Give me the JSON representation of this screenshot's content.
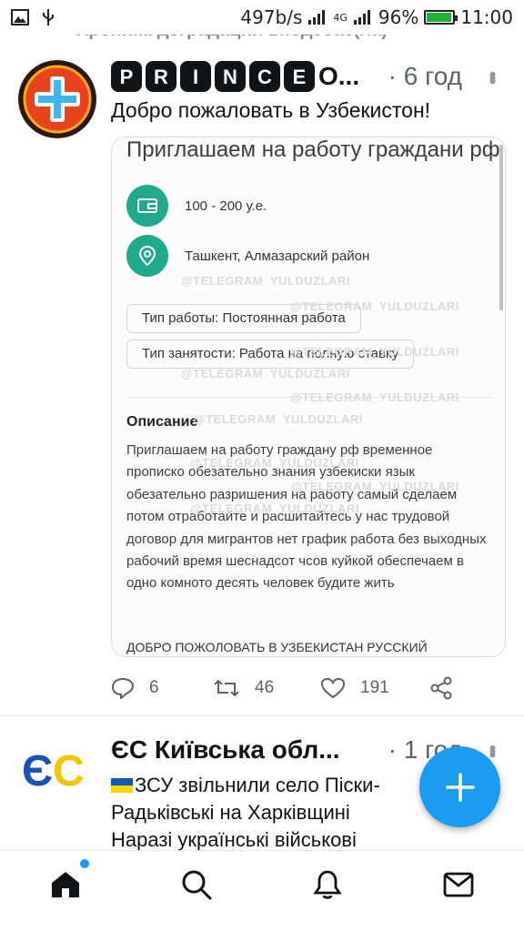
{
  "status_bar": {
    "speed": "497b/s",
    "network": "4G",
    "battery_percent": "96%",
    "battery_level": 0.96,
    "time": "11:00"
  },
  "context_line": "Хроника деградации вподсбас(ла)",
  "tweet1": {
    "name_letters": [
      "P",
      "R",
      "I",
      "N",
      "C",
      "E"
    ],
    "name_tail": "O...",
    "time": "· 6 год",
    "text": "Добро пожаловать в Узбекистон!",
    "media": {
      "title": "Приглашаем на работу граждани рф",
      "salary": "100 - 200 у.е.",
      "location": "Ташкент, Алмазарский район",
      "chip_work_type": "Тип работы: Постоянная работа",
      "chip_employment": "Тип занятости: Работа на полную ставку",
      "description_heading": "Описание",
      "description": "Приглашаем на работу гражданy рф временное прописко обезательно знания узбекиски язык обезательно разришения на работу самый сделаем потом отработайте и расшитайтесь у нас трудовой договор для мигрантов нет график работа без выходных рабочий время шеснадсот чсов куйкой обеспечаем в одно комното десять человек будите жить",
      "footer": "ДОБРО ПОЖОЛОВАТЬ В УЗБЕКИСТАН РУССКИЙ",
      "watermark": "@TELEGRAM_YULDUZLARI"
    },
    "replies": "6",
    "retweets": "46",
    "likes": "191"
  },
  "tweet2": {
    "name": "ЄС Київська обл...",
    "time": "· 1 год",
    "avatar_text": "ЄС",
    "text": "ЗСУ звільнили село Піски-Радьківські на Харківщині\nНаразі українські військові"
  },
  "colors": {
    "accent": "#1d9bf0",
    "teal": "#21a98c",
    "text": "#0f1419",
    "muted": "#536471"
  },
  "icons": {
    "nav": [
      "home-icon",
      "search-icon",
      "bell-icon",
      "mail-icon"
    ],
    "actions": [
      "reply-icon",
      "retweet-icon",
      "like-icon",
      "share-icon"
    ],
    "fab": "plus-icon"
  }
}
